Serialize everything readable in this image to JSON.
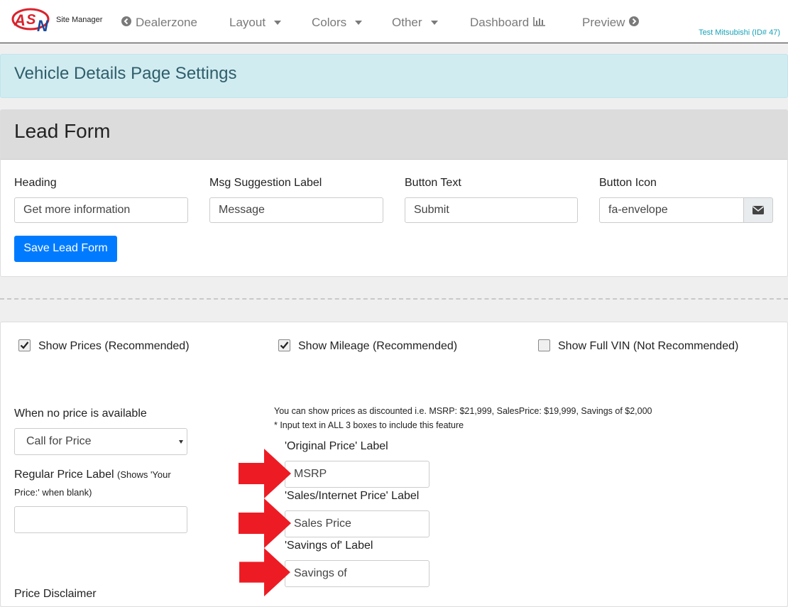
{
  "nav": {
    "brand": "Site Manager",
    "dealerzone": "Dealerzone",
    "layout": "Layout",
    "colors": "Colors",
    "other": "Other",
    "dashboard": "Dashboard",
    "preview": "Preview",
    "dealer": "Test Mitsubishi (ID# 47)"
  },
  "page_title": "Vehicle Details Page Settings",
  "lead_form": {
    "title": "Lead Form",
    "heading_label": "Heading",
    "heading_value": "Get more information",
    "msg_label": "Msg Suggestion Label",
    "msg_value": "Message",
    "button_text_label": "Button Text",
    "button_text_value": "Submit",
    "button_icon_label": "Button Icon",
    "button_icon_value": "fa-envelope",
    "save_label": "Save Lead Form"
  },
  "options": {
    "show_prices": "Show Prices (Recommended)",
    "show_prices_checked": true,
    "show_mileage": "Show Mileage (Recommended)",
    "show_mileage_checked": true,
    "show_full_vin": "Show Full VIN (Not Recommended)",
    "show_full_vin_checked": false
  },
  "pricing": {
    "no_price_label": "When no price is available",
    "no_price_value": "Call for Price",
    "regular_price_label": "Regular Price Label",
    "regular_price_hint_1": "(Shows 'Your",
    "regular_price_hint_2": "Price:' when blank)",
    "regular_price_value": "",
    "disclaimer_label": "Price Disclaimer",
    "note_1": "You can show prices as discounted i.e. MSRP: $21,999, SalesPrice: $19,999, Savings of $2,000",
    "note_2": "* Input text in ALL 3 boxes to include this feature",
    "original_label": "'Original Price' Label",
    "original_value": "MSRP",
    "sales_label": "'Sales/Internet Price' Label",
    "sales_value": "Sales Price",
    "savings_label": "'Savings of' Label",
    "savings_value": "Savings of"
  },
  "colors": {
    "primary": "#007bff",
    "alert_bg": "#d1ecf1",
    "accent_red": "#ed1c24",
    "link_teal": "#17a2b8"
  },
  "icons": [
    "asn-logo",
    "arrow-circle-left-icon",
    "bar-chart-icon",
    "arrow-circle-right-icon",
    "envelope-icon",
    "checkbox-icon",
    "red-arrow-icon"
  ]
}
